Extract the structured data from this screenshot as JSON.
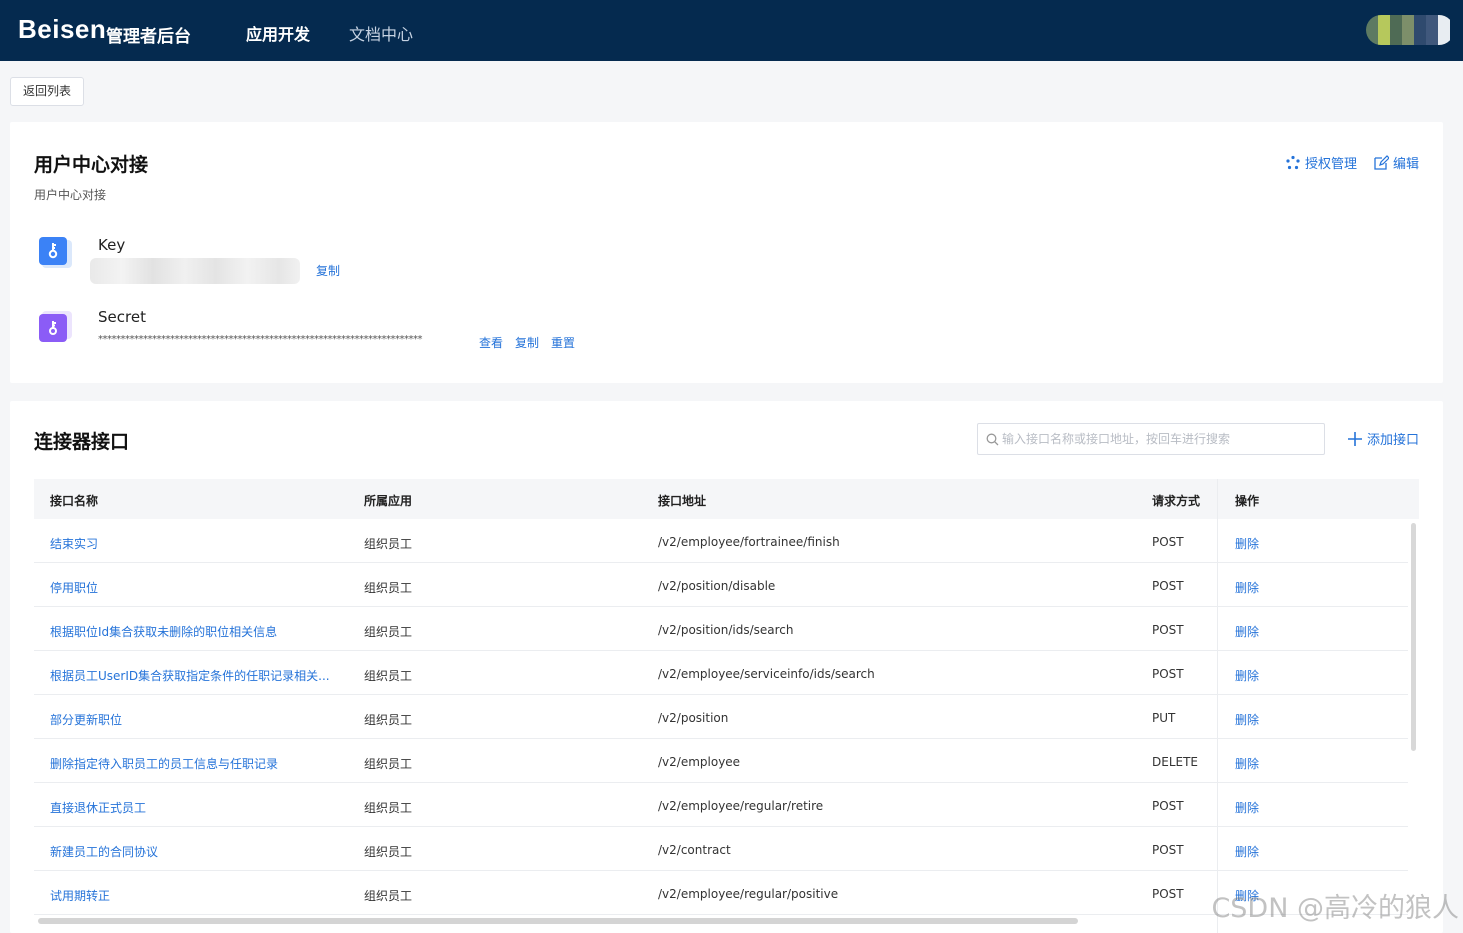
{
  "header": {
    "logo": "Beisen",
    "logo_sub": "管理者后台",
    "nav": [
      {
        "label": "应用开发",
        "active": true
      },
      {
        "label": "文档中心",
        "active": false
      }
    ]
  },
  "back_button": "返回列表",
  "app": {
    "title": "用户中心对接",
    "description": "用户中心对接",
    "actions": {
      "auth": "授权管理",
      "edit": "编辑"
    },
    "key": {
      "label": "Key",
      "copy": "复制"
    },
    "secret": {
      "label": "Secret",
      "masked": "************************************************************************",
      "view": "查看",
      "copy": "复制",
      "reset": "重置"
    }
  },
  "connector": {
    "title": "连接器接口",
    "search_placeholder": "输入接口名称或接口地址，按回车进行搜索",
    "add_label": "添加接口",
    "columns": [
      "接口名称",
      "所属应用",
      "接口地址",
      "请求方式",
      "操作"
    ],
    "rows": [
      {
        "name": "结束实习",
        "app": "组织员工",
        "path": "/v2/employee/fortrainee/finish",
        "method": "POST",
        "action": "删除"
      },
      {
        "name": "停用职位",
        "app": "组织员工",
        "path": "/v2/position/disable",
        "method": "POST",
        "action": "删除"
      },
      {
        "name": "根据职位Id集合获取未删除的职位相关信息",
        "app": "组织员工",
        "path": "/v2/position/ids/search",
        "method": "POST",
        "action": "删除"
      },
      {
        "name": "根据员工UserID集合获取指定条件的任职记录相关...",
        "app": "组织员工",
        "path": "/v2/employee/serviceinfo/ids/search",
        "method": "POST",
        "action": "删除"
      },
      {
        "name": "部分更新职位",
        "app": "组织员工",
        "path": "/v2/position",
        "method": "PUT",
        "action": "删除"
      },
      {
        "name": "删除指定待入职员工的员工信息与任职记录",
        "app": "组织员工",
        "path": "/v2/employee",
        "method": "DELETE",
        "action": "删除"
      },
      {
        "name": "直接退休正式员工",
        "app": "组织员工",
        "path": "/v2/employee/regular/retire",
        "method": "POST",
        "action": "删除"
      },
      {
        "name": "新建员工的合同协议",
        "app": "组织员工",
        "path": "/v2/contract",
        "method": "POST",
        "action": "删除"
      },
      {
        "name": "试用期转正",
        "app": "组织员工",
        "path": "/v2/employee/regular/positive",
        "method": "POST",
        "action": "删除"
      }
    ]
  },
  "watermark": "CSDN @高冷的狼人",
  "colors": {
    "header_bg": "#052a4f",
    "link": "#2573d9",
    "key_icon": "#3b82f6",
    "secret_icon": "#8b5cf6"
  }
}
